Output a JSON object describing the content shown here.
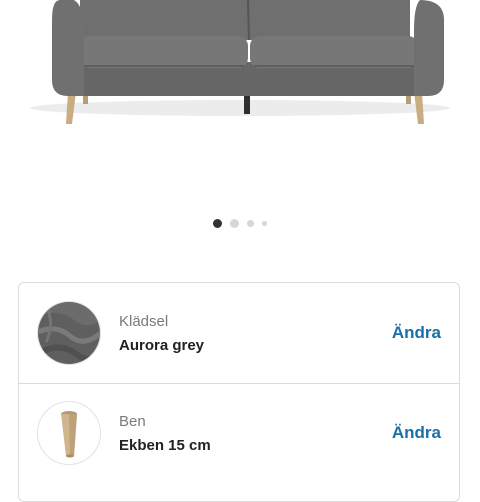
{
  "product_image": {
    "alt": "Grey three-seat sofa with wooden legs"
  },
  "carousel": {
    "slides": 4,
    "active_index": 0
  },
  "options": [
    {
      "label": "Klädsel",
      "value": "Aurora grey",
      "action": "Ändra",
      "icon": "fabric-swatch-icon"
    },
    {
      "label": "Ben",
      "value": "Ekben 15 cm",
      "action": "Ändra",
      "icon": "wooden-leg-icon"
    }
  ],
  "colors": {
    "link": "#1a6fa5",
    "sofa": "#6e6e6e",
    "legs": "#c8ad82"
  }
}
